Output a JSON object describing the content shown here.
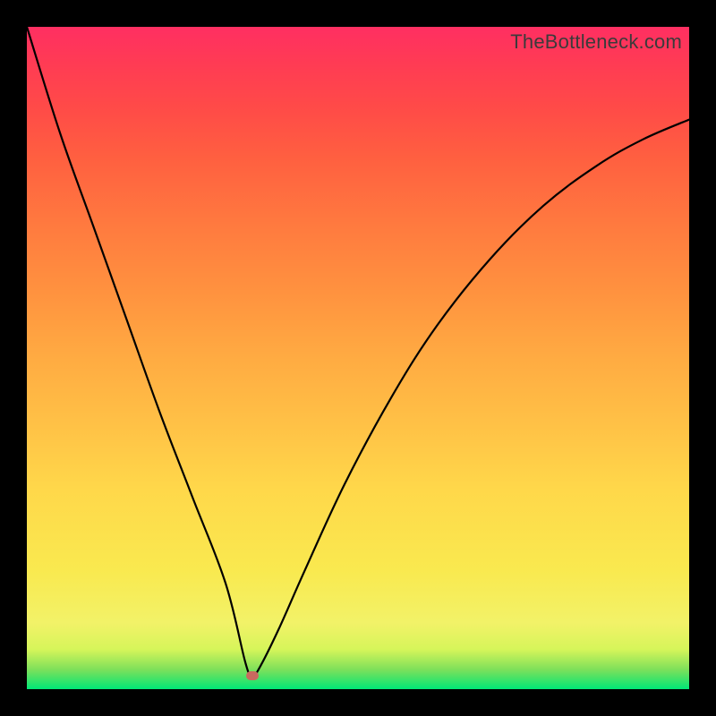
{
  "watermark": "TheBottleneck.com",
  "colors": {
    "frame": "#000000",
    "curve": "#000000",
    "marker": "#c96a5f",
    "gradient_stops": [
      "#00e676",
      "#7fe05a",
      "#d6f55a",
      "#f2f268",
      "#f9e94f",
      "#ffd84a",
      "#ffc146",
      "#ffab42",
      "#ff923f",
      "#ff7a3f",
      "#ff6040",
      "#ff4a48",
      "#ff3a55",
      "#ff2f62"
    ]
  },
  "chart_data": {
    "type": "line",
    "title": "",
    "xlabel": "",
    "ylabel": "",
    "xlim": [
      0,
      100
    ],
    "ylim": [
      0,
      100
    ],
    "notes": "V-shaped bottleneck curve; minimum near x≈34; each branch is convex rising away from the minimum. Values are approximate (no axis labels in source).",
    "series": [
      {
        "name": "bottleneck-curve",
        "x": [
          0,
          5,
          10,
          15,
          20,
          25,
          30,
          33,
          34,
          35,
          38,
          42,
          48,
          55,
          62,
          70,
          78,
          86,
          93,
          100
        ],
        "y": [
          100,
          84,
          70,
          56,
          42,
          29,
          16,
          4,
          2,
          3,
          9,
          18,
          31,
          44,
          55,
          65,
          73,
          79,
          83,
          86
        ]
      }
    ],
    "marker": {
      "x": 34,
      "y": 2
    }
  }
}
